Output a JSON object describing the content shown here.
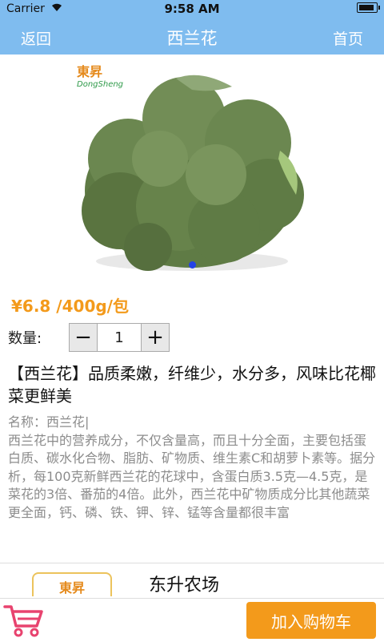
{
  "status_bar": {
    "carrier": "Carrier",
    "time": "9:58 AM"
  },
  "nav": {
    "back_label": "返回",
    "title": "西兰花",
    "home_label": "首页"
  },
  "brand": {
    "cn": "東昇",
    "en": "DongSheng"
  },
  "product": {
    "price": "¥6.8 /400g/包",
    "quantity_label": "数量:",
    "minus": "−",
    "quantity": "1",
    "plus": "+",
    "headline": "【西兰花】品质柔嫩，纤维少，水分多，风味比花椰菜更鲜美",
    "name_line": "名称：西兰花|",
    "description": "西兰花中的营养成分，不仅含量高，而且十分全面，主要包括蛋白质、碳水化合物、脂肪、矿物质、维生素C和胡萝卜素等。据分析，每100克新鲜西兰花的花球中，含蛋白质3.5克—4.5克，是菜花的3倍、番茄的4倍。此外，西兰花中矿物质成分比其他蔬菜更全面，钙、磷、铁、钾、锌、锰等含量都很丰富"
  },
  "store": {
    "logo_text": "東昇",
    "name": "东升农场"
  },
  "bottom": {
    "add_to_cart": "加入购物车"
  },
  "colors": {
    "nav_bg": "#7fbcef",
    "accent": "#f39a1b",
    "cart_icon": "#e8436f"
  }
}
